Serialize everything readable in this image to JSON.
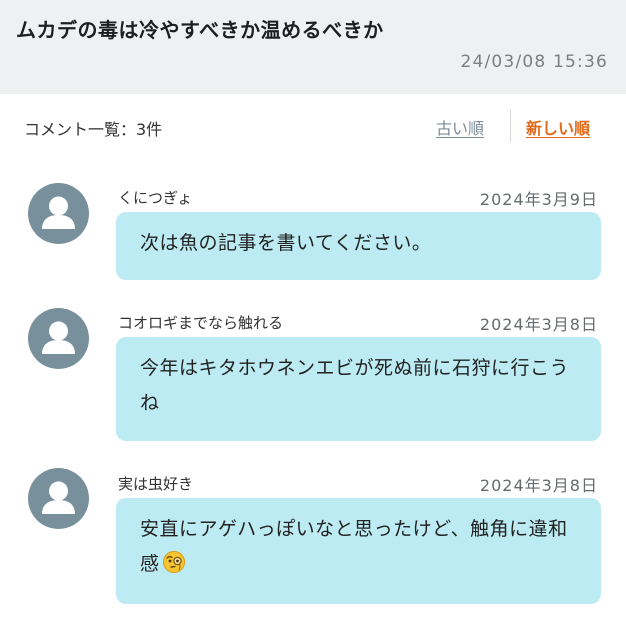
{
  "article": {
    "title": "ムカデの毒は冷やすべきか温めるべきか",
    "datetime": "24/03/08 15:36"
  },
  "comments_header": {
    "count_label": "コメント一覧：3件",
    "sort_old_label": "古い順",
    "sort_new_label": "新しい順",
    "active_sort": "new",
    "active_color": "#e2691c",
    "inactive_color": "#7c8c99"
  },
  "comments": [
    {
      "author": "くにつぎょ",
      "date": "2024年3月9日",
      "text": "次は魚の記事を書いてください。",
      "avatar_icon": "user-silhouette-icon"
    },
    {
      "author": "コオロギまでなら触れる",
      "date": "2024年3月8日",
      "text": "今年はキタホウネンエビが死ぬ前に石狩に行こうね",
      "avatar_icon": "user-silhouette-icon"
    },
    {
      "author": "実は虫好き",
      "date": "2024年3月8日",
      "text": "安直にアゲハっぽいなと思ったけど、触角に違和感",
      "avatar_icon": "user-silhouette-icon",
      "trailing_icon": "face-with-monocle-icon"
    }
  ],
  "colors": {
    "header_bg": "#eef0f2",
    "bubble_bg": "#bcebf3",
    "avatar_bg": "#788f9c"
  }
}
